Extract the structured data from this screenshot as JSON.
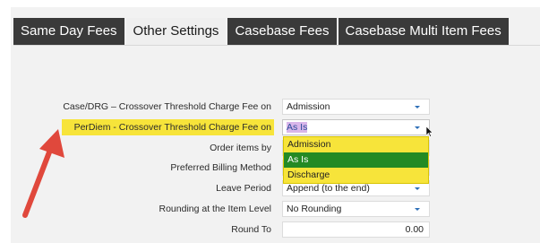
{
  "tabs": [
    {
      "label": "Same Day Fees",
      "active": false
    },
    {
      "label": "Other Settings",
      "active": true
    },
    {
      "label": "Casebase Fees",
      "active": false
    },
    {
      "label": "Casebase Multi Item Fees",
      "active": false
    }
  ],
  "form": {
    "rows": [
      {
        "label": "Case/DRG – Crossover Threshold Charge Fee on",
        "value": "Admission"
      },
      {
        "label": "PerDiem - Crossover Threshold Charge Fee on",
        "value": "As Is"
      },
      {
        "label": "Order items by",
        "value": ""
      },
      {
        "label": "Preferred Billing Method",
        "value": ""
      },
      {
        "label": "Leave Period",
        "value": "Append (to the end)"
      },
      {
        "label": "Rounding at the Item Level",
        "value": "No Rounding"
      },
      {
        "label": "Round To",
        "value": "0.00"
      }
    ]
  },
  "dropdown": {
    "options": [
      "Admission",
      "As Is",
      "Discharge"
    ],
    "highlighted": "As Is"
  },
  "colors": {
    "tab_dark": "#3a3a3a",
    "highlight_yellow": "#f7e43a",
    "option_hover_green": "#238a24",
    "annotation_arrow": "#e0483c",
    "caret_blue": "#2d6fb7"
  },
  "icons": {
    "dropdown_caret": "chevron-down-icon",
    "mouse_cursor": "pointer-cursor-icon",
    "annotation": "red-arrow-icon"
  }
}
